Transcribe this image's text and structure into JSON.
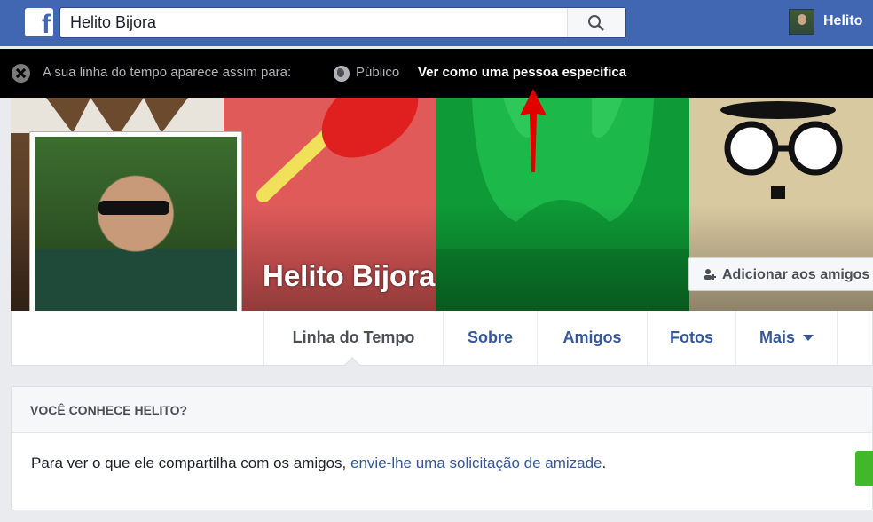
{
  "topbar": {
    "logo_letter": "f",
    "search_value": "Helito Bijora",
    "user_name": "Helito",
    "brand_color": "#4267b2"
  },
  "view_as_bar": {
    "message": "A sua linha do tempo aparece assim para:",
    "audience": "Público",
    "link": "Ver como uma pessoa específica"
  },
  "profile": {
    "name": "Helito Bijora",
    "add_friend_label": "Adicionar aos amigos"
  },
  "tabs": [
    {
      "label": "Linha do Tempo"
    },
    {
      "label": "Sobre"
    },
    {
      "label": "Amigos"
    },
    {
      "label": "Fotos"
    },
    {
      "label": "Mais"
    }
  ],
  "know_card": {
    "title": "VOCÊ CONHECE HELITO?",
    "text_before": "Para ver o que ele compartilha com os amigos, ",
    "link": "envie-lhe uma solicitação de amizade",
    "text_after": "."
  }
}
